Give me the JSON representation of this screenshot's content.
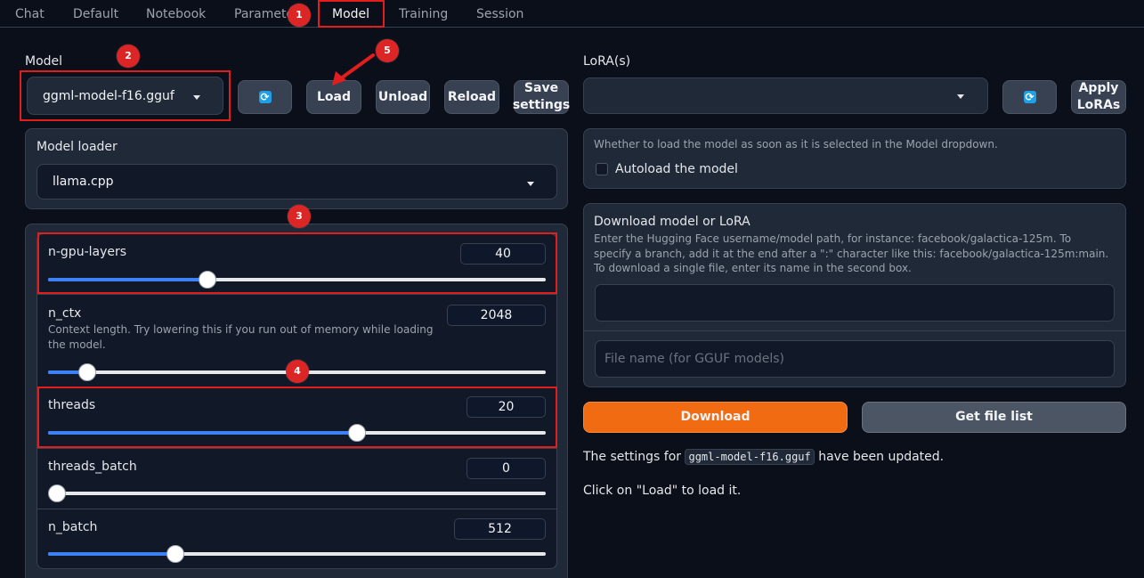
{
  "tabs": [
    "Chat",
    "Default",
    "Notebook",
    "Parameters",
    "Model",
    "Training",
    "Session"
  ],
  "annotations": [
    "1",
    "2",
    "3",
    "4",
    "5"
  ],
  "model": {
    "label": "Model",
    "selected": "ggml-model-f16.gguf",
    "buttons": {
      "load": "Load",
      "unload": "Unload",
      "reload": "Reload",
      "save": "Save settings"
    }
  },
  "loader": {
    "label": "Model loader",
    "selected": "llama.cpp"
  },
  "sliders": [
    {
      "name": "n-gpu-layers",
      "value": "40",
      "fraction": 0.32
    },
    {
      "name": "n_ctx",
      "value": "2048",
      "fraction": 0.078,
      "description": "Context length. Try lowering this if you run out of memory while loading the model."
    },
    {
      "name": "threads",
      "value": "20",
      "fraction": 0.62
    },
    {
      "name": "threads_batch",
      "value": "0",
      "fraction": 0.0
    },
    {
      "name": "n_batch",
      "value": "512",
      "fraction": 0.255
    }
  ],
  "lora": {
    "label": "LoRA(s)",
    "apply": "Apply LoRAs"
  },
  "autoload": {
    "info": "Whether to load the model as soon as it is selected in the Model dropdown.",
    "label": "Autoload the model",
    "checked": false
  },
  "download": {
    "title": "Download model or LoRA",
    "description": "Enter the Hugging Face username/model path, for instance: facebook/galactica-125m. To specify a branch, add it at the end after a \":\" character like this: facebook/galactica-125m:main. To download a single file, enter its name in the second box.",
    "path_value": "",
    "file_placeholder": "File name (for GGUF models)",
    "download_button": "Download",
    "file_list_button": "Get file list"
  },
  "status": {
    "prefix": "The settings for",
    "model_code": "ggml-model-f16.gguf",
    "suffix": "have been updated.",
    "hint": "Click on \"Load\" to load it."
  },
  "colors": {
    "accent": "#f97316",
    "annotation": "#e11d1d",
    "slider_fill": "#3b82f6"
  }
}
